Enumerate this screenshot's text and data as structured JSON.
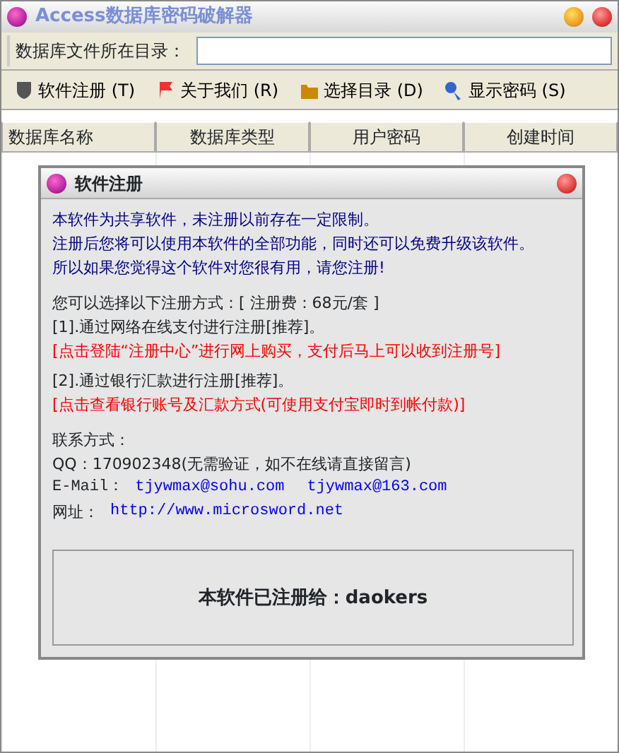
{
  "window": {
    "title": "Access数据库密码破解器"
  },
  "path_field": {
    "label": "数据库文件所在目录："
  },
  "toolbar": [
    {
      "label": "软件注册 (T)"
    },
    {
      "label": "关于我们 (R)"
    },
    {
      "label": "选择目录 (D)"
    },
    {
      "label": "显示密码 (S)"
    }
  ],
  "table": {
    "columns": [
      "数据库名称",
      "数据库类型",
      "用户密码",
      "创建时间"
    ]
  },
  "dialog": {
    "title": "软件注册",
    "intro": [
      "本软件为共享软件，未注册以前存在一定限制。",
      "注册后您将可以使用本软件的全部功能，同时还可以免费升级该软件。",
      "所以如果您觉得这个软件对您很有用，请您注册!"
    ],
    "methods_heading": "您可以选择以下注册方式：[ 注册费：68元/套 ]",
    "methods": [
      {
        "text": "[1].通过网络在线支付进行注册[推荐]。",
        "link": "[点击登陆“注册中心”进行网上购买，支付后马上可以收到注册号]"
      },
      {
        "text": "[2].通过银行汇款进行注册[推荐]。",
        "link": "[点击查看银行账号及汇款方式(可使用支付宝即时到帐付款)]"
      }
    ],
    "contact_heading": "联系方式：",
    "qq": "QQ：170902348(无需验证，如不在线请直接留言)",
    "email_label": "E-Mail：",
    "emails": [
      "tjywmax@sohu.com",
      "tjywmax@163.com"
    ],
    "website_label": "网址：",
    "website": "http://www.microsword.net",
    "registered": "本软件已注册给：daokers"
  }
}
